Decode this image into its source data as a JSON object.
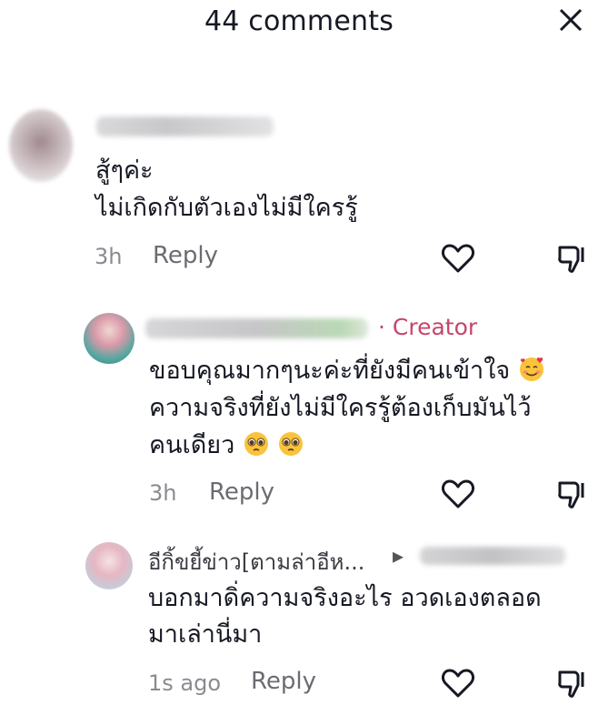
{
  "header": {
    "title": "44 comments",
    "close_icon": "close-icon"
  },
  "comments": [
    {
      "text_lines": [
        "สู้ๆค่ะ",
        "ไม่เกิดกับตัวเองไม่มีใครรู้"
      ],
      "time": "3h",
      "reply_label": "Reply"
    },
    {
      "badge": "· Creator",
      "text_lines": [
        "ขอบคุณมากๆนะค่ะที่ยังมีคนเข้าใจ",
        "ความจริงที่ยังไม่มีใครรู้ต้องเก็บมันไว้",
        "คนเดียว"
      ],
      "time": "3h",
      "reply_label": "Reply"
    },
    {
      "username": "อีกิ้ขยี้ข่าว[ตามล่าอีห...",
      "reply_arrow": "▸",
      "text_lines": [
        "บอกมาดิ่ความจริงอะไร อวดเองตลอด",
        "มาเล่านี่มา"
      ],
      "time": "1s ago",
      "reply_label": "Reply"
    }
  ],
  "icons": {
    "like": "heart-outline-icon",
    "dislike": "thumbs-down-icon"
  },
  "colors": {
    "text": "#161823",
    "muted": "#8a8b91",
    "creator": "#c7456b"
  }
}
